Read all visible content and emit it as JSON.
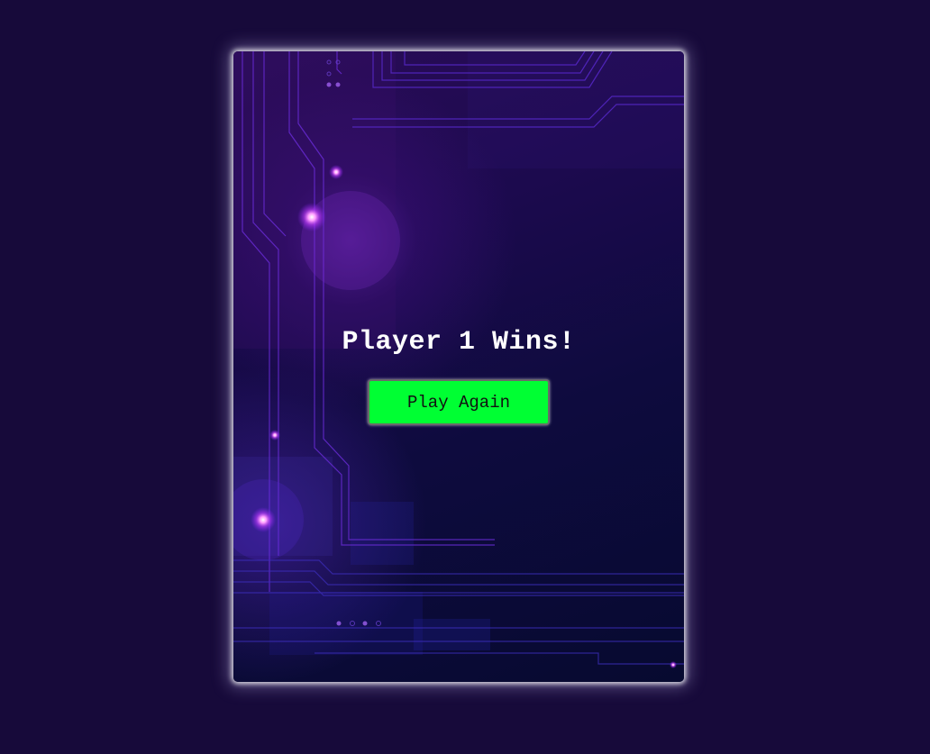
{
  "game": {
    "result_message": "Player 1 Wins!",
    "play_again_label": "Play Again"
  },
  "colors": {
    "page_background": "#170a3a",
    "button_background": "#00ff33",
    "title_color": "#ffffff",
    "circuit_glow": "#b040ff"
  }
}
